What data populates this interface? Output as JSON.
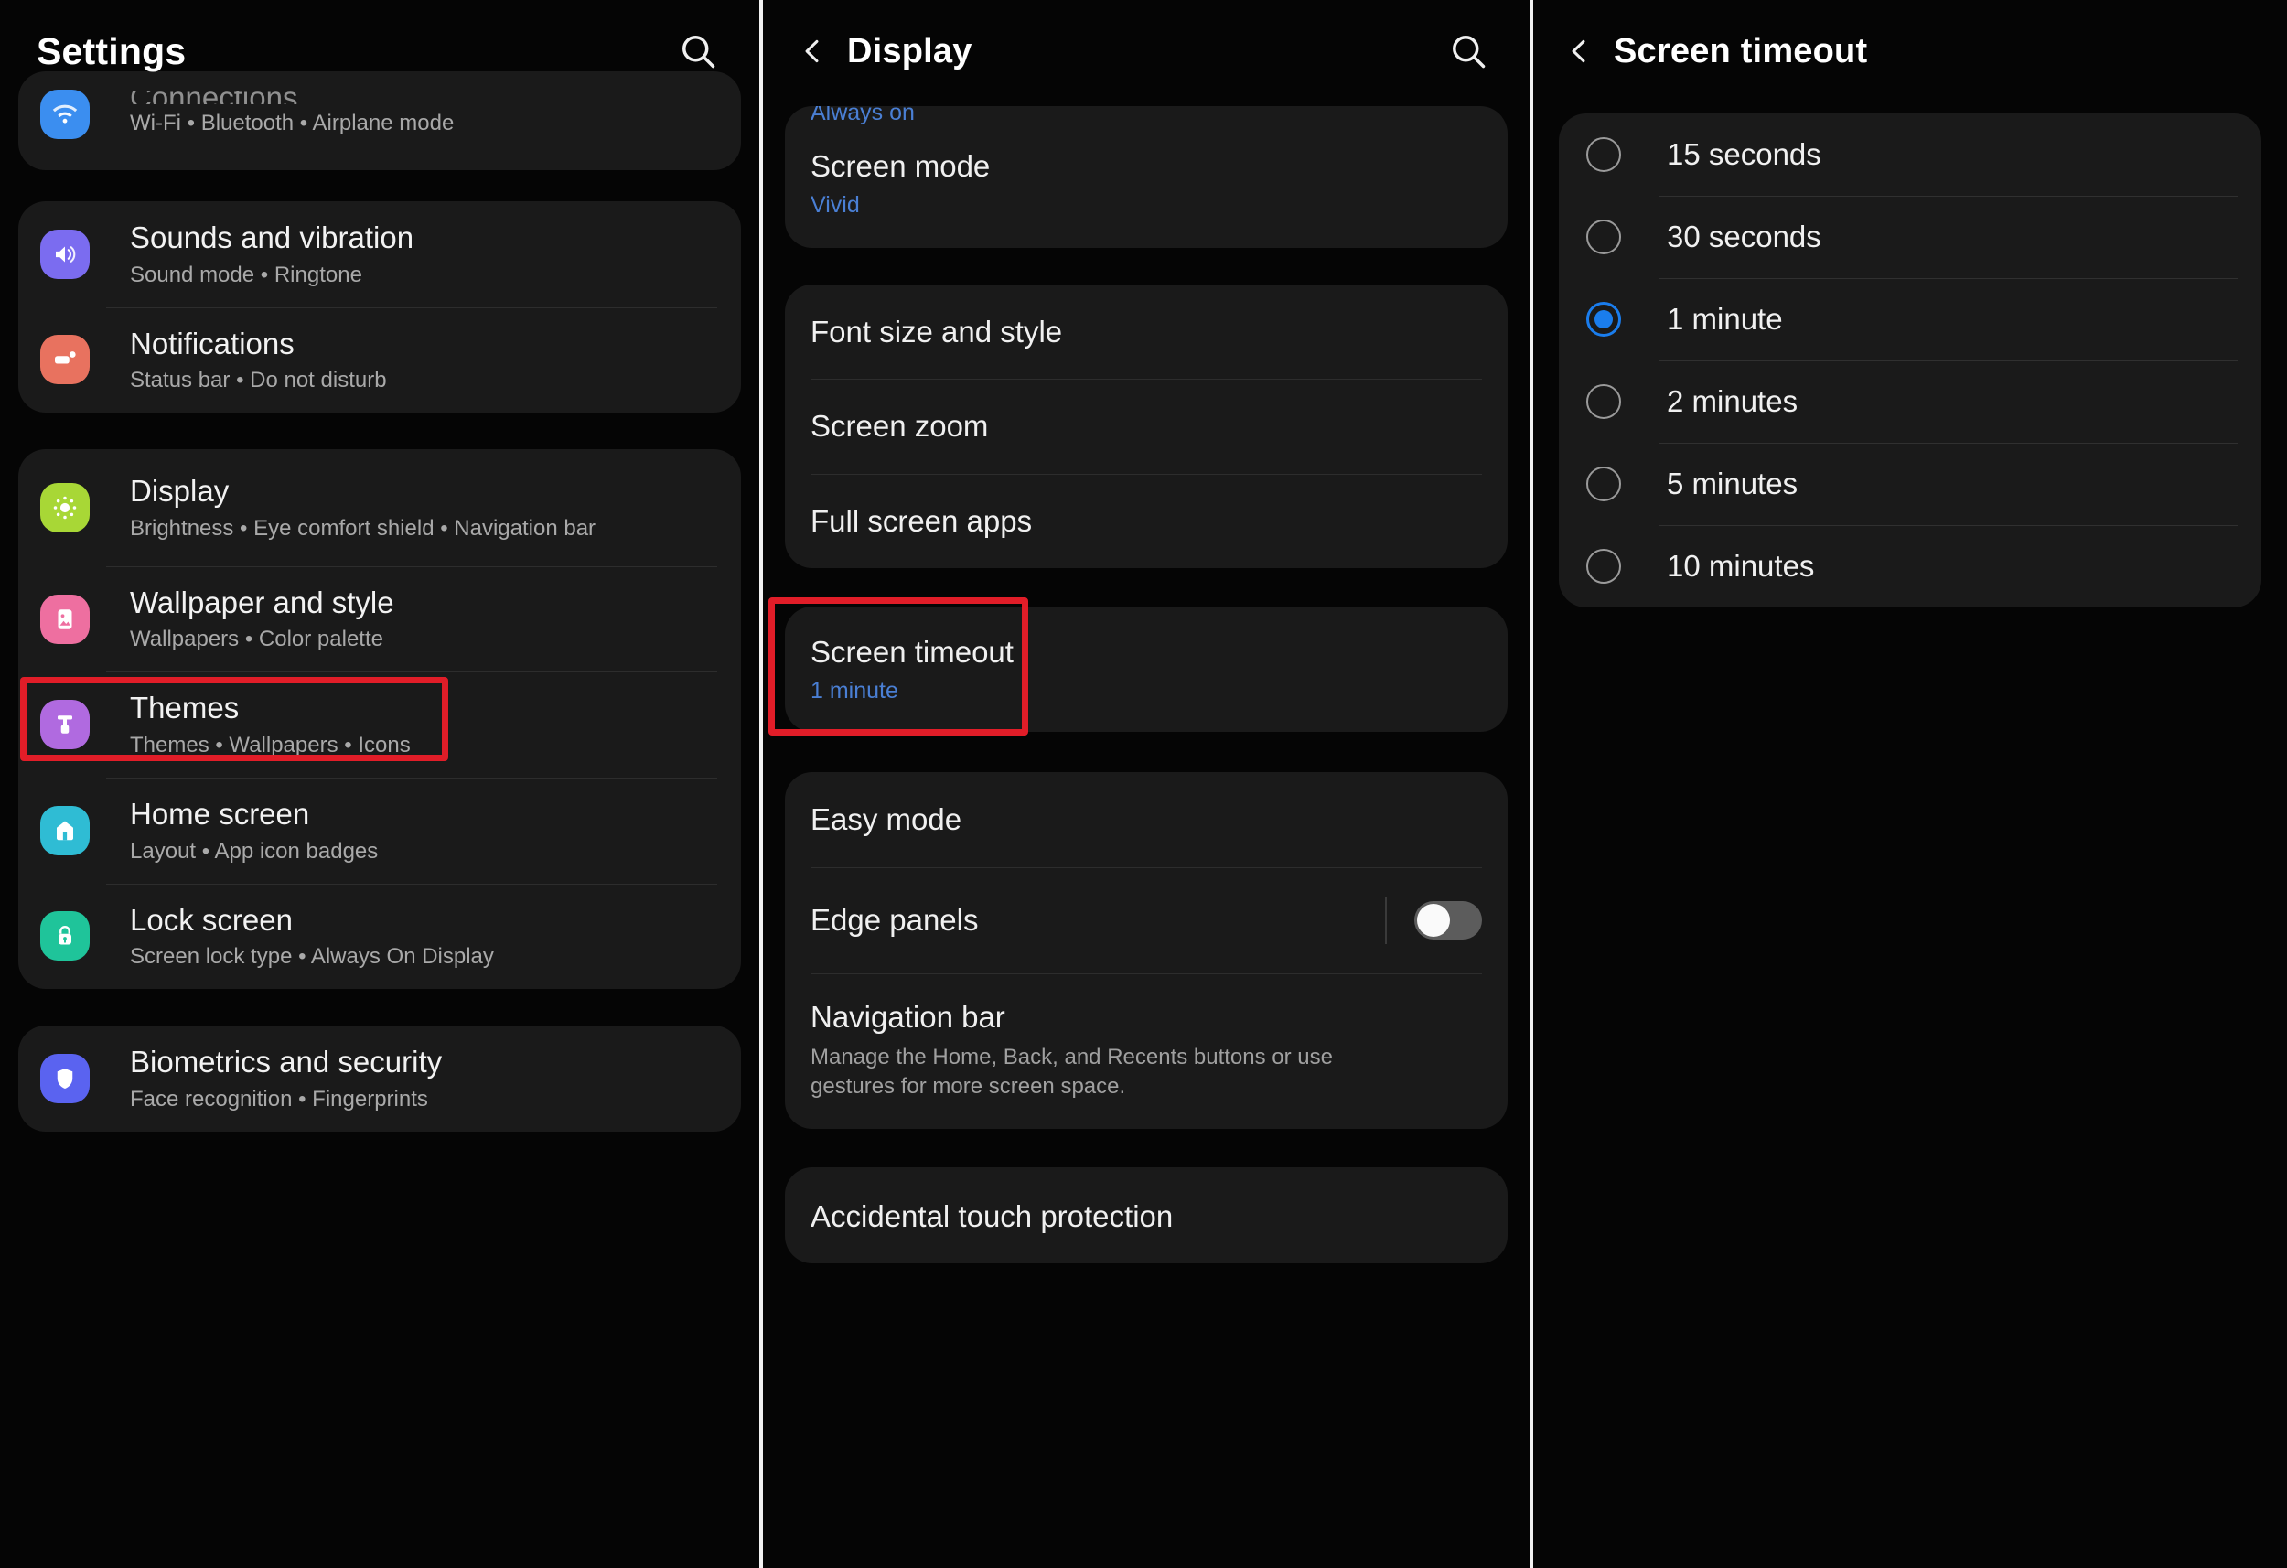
{
  "panels": {
    "settings": {
      "header": {
        "title": "Settings",
        "search_icon": "search-icon"
      },
      "groups": [
        {
          "items": [
            {
              "name": "Connections",
              "desc": "Wi-Fi  •  Bluetooth  •  Airplane mode",
              "icon": "wifi-icon",
              "color": "#3b8ef0",
              "clipped": true
            }
          ]
        },
        {
          "items": [
            {
              "name": "Sounds and vibration",
              "desc": "Sound mode  •  Ringtone",
              "icon": "volume-icon",
              "color": "#7b6cf0"
            },
            {
              "name": "Notifications",
              "desc": "Status bar  •  Do not disturb",
              "icon": "notification-icon",
              "color": "#e8725f"
            }
          ]
        },
        {
          "items": [
            {
              "name": "Display",
              "desc": "Brightness  •  Eye comfort shield  •  Navigation bar",
              "icon": "brightness-icon",
              "color": "#a8d736",
              "highlighted": true
            },
            {
              "name": "Wallpaper and style",
              "desc": "Wallpapers  •  Color palette",
              "icon": "wallpaper-icon",
              "color": "#ee6fa0"
            },
            {
              "name": "Themes",
              "desc": "Themes  •  Wallpapers  •  Icons",
              "icon": "themes-icon",
              "color": "#b06ae0"
            },
            {
              "name": "Home screen",
              "desc": "Layout  •  App icon badges",
              "icon": "home-icon",
              "color": "#2fbcd4"
            },
            {
              "name": "Lock screen",
              "desc": "Screen lock type  •  Always On Display",
              "icon": "lock-icon",
              "color": "#1fc49a"
            }
          ]
        },
        {
          "items": [
            {
              "name": "Biometrics and security",
              "desc": "Face recognition  •  Fingerprints",
              "icon": "shield-icon",
              "color": "#5a63f0",
              "clipped_bottom": true
            }
          ]
        }
      ]
    },
    "display": {
      "header": {
        "title": "Display",
        "back_icon": "chevron-left-icon",
        "search_icon": "search-icon"
      },
      "clipped_top_value": "Always on",
      "groups": [
        {
          "rows": [
            {
              "name": "Screen mode",
              "value": "Vivid"
            }
          ]
        },
        {
          "rows": [
            {
              "name": "Font size and style"
            },
            {
              "name": "Screen zoom"
            },
            {
              "name": "Full screen apps"
            }
          ]
        },
        {
          "rows": [
            {
              "name": "Screen timeout",
              "value": "1 minute",
              "highlighted": true
            }
          ]
        },
        {
          "rows": [
            {
              "name": "Easy mode"
            },
            {
              "name": "Edge panels",
              "toggle": "off"
            },
            {
              "name": "Navigation bar",
              "body": "Manage the Home, Back, and Recents buttons or use gestures for more screen space."
            }
          ]
        },
        {
          "rows": [
            {
              "name": "Accidental touch protection",
              "clipped_bottom": true
            }
          ]
        }
      ]
    },
    "screen_timeout": {
      "header": {
        "title": "Screen timeout",
        "back_icon": "chevron-left-icon"
      },
      "selected": "1 minute",
      "options": [
        {
          "label": "15 seconds",
          "selected": false
        },
        {
          "label": "30 seconds",
          "selected": false
        },
        {
          "label": "1 minute",
          "selected": true
        },
        {
          "label": "2 minutes",
          "selected": false
        },
        {
          "label": "5 minutes",
          "selected": false
        },
        {
          "label": "10 minutes",
          "selected": false
        }
      ]
    }
  },
  "annotation": {
    "color": "#e11d28",
    "boxes": [
      "display-row-highlight",
      "screen-timeout-row-highlight"
    ]
  }
}
